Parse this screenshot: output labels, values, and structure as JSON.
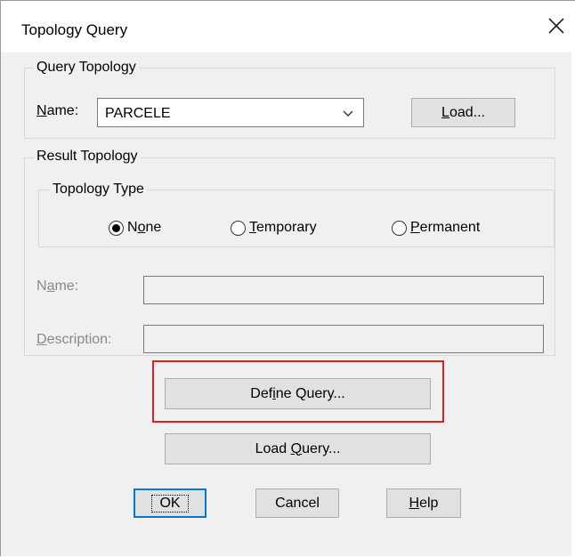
{
  "window": {
    "title": "Topology Query"
  },
  "query_topology": {
    "legend": "Query Topology",
    "name_label_prefix": "N",
    "name_label_rest": "ame:",
    "name_value": "PARCELE",
    "load_prefix": "L",
    "load_rest": "oad..."
  },
  "result_topology": {
    "legend": "Result Topology",
    "topology_type": {
      "legend": "Topology Type",
      "options": [
        {
          "pre": "N",
          "u": "o",
          "post": "ne",
          "checked": true
        },
        {
          "pre": "",
          "u": "T",
          "post": "emporary",
          "checked": false
        },
        {
          "pre": "",
          "u": "P",
          "post": "ermanent",
          "checked": false
        }
      ]
    },
    "name_pre": "N",
    "name_u": "a",
    "name_post": "me:",
    "desc_u": "D",
    "desc_post": "escription:"
  },
  "buttons": {
    "define_pre": "Def",
    "define_u": "i",
    "define_post": "ne Query...",
    "loadq_pre": "Load ",
    "loadq_u": "Q",
    "loadq_post": "uery...",
    "ok": "OK",
    "cancel": "Cancel",
    "help_u": "H",
    "help_post": "elp"
  }
}
